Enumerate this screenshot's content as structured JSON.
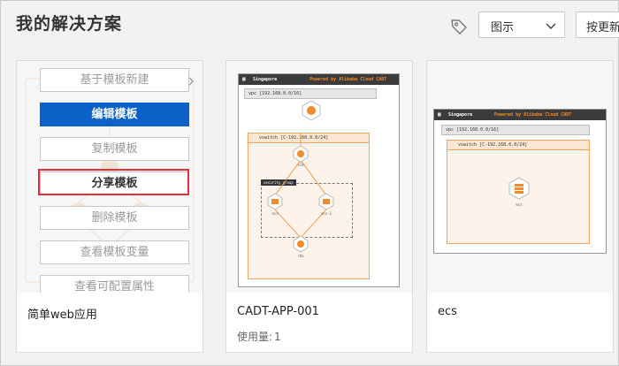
{
  "header": {
    "title": "我的解决方案",
    "view_select": {
      "value": "图示"
    },
    "sort_button": "按更新"
  },
  "cards": [
    {
      "name": "简单web应用",
      "menu": [
        "基于模板新建",
        "编辑模板",
        "复制模板",
        "分享模板",
        "删除模板",
        "查看模板变量",
        "查看可配置属性"
      ]
    },
    {
      "name": "CADT-APP-001",
      "usage_label": "使用量:",
      "usage_value": "1",
      "diagram": {
        "region": "Singapore",
        "powered": "Powered by Alibaba Cloud CADT",
        "vpc": "vpc [192.168.0.0/16]",
        "vswitch": "vswitch [C-192.168.0.0/24]",
        "security_group": "security_group",
        "nodes": [
          "ecs",
          "ecs-1",
          "slb",
          "rds"
        ]
      }
    },
    {
      "name": "ecs",
      "diagram": {
        "region": "Singapore",
        "powered": "Powered by Alibaba Cloud CADT",
        "vpc": "vpc [192.168.0.0/16]",
        "vswitch": "vswitch [C-192.168.0.0/24]",
        "nodes": [
          "ecs"
        ]
      }
    }
  ]
}
